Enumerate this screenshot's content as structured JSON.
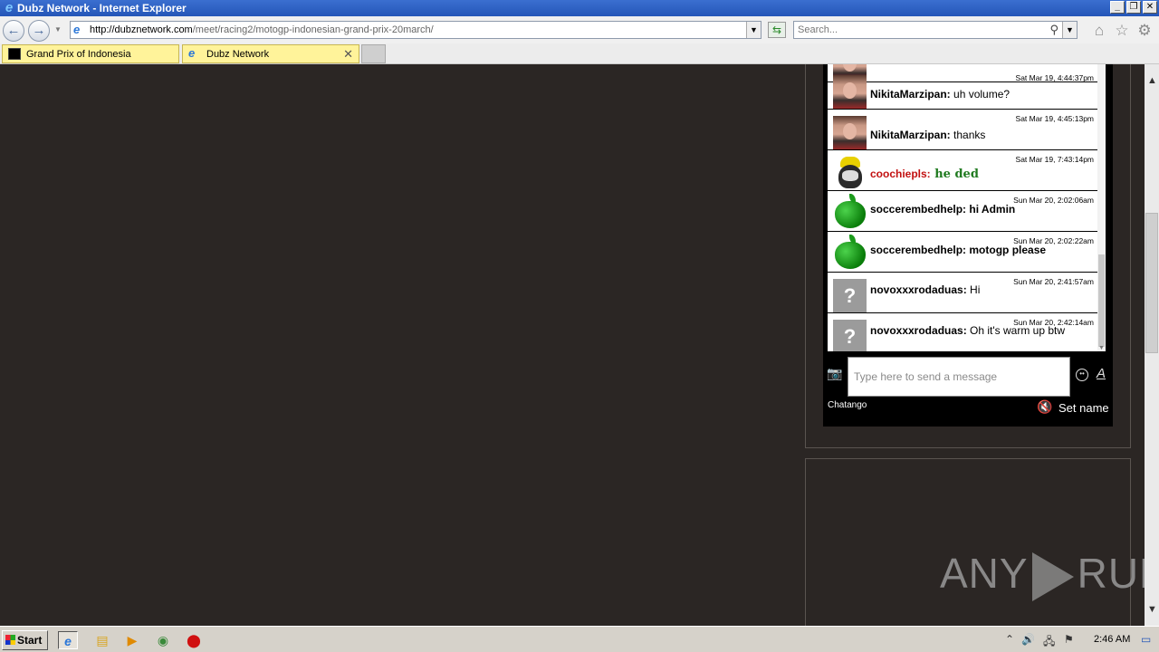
{
  "window": {
    "title": "Dubz Network - Internet Explorer"
  },
  "navbar": {
    "url_host": "http://dubznetwork.com",
    "url_path": "/meet/racing2/motogp-indonesian-grand-prix-20march/",
    "search_placeholder": "Search..."
  },
  "tabs": [
    {
      "label": "Grand Prix of Indonesia"
    },
    {
      "label": "Dubz Network"
    }
  ],
  "chat": {
    "messages": [
      {
        "time": "Sat Mar 19, 4:44:37pm",
        "user": "NikitaMarzipan:",
        "text": " uh volume?",
        "avatar": "racer-photo"
      },
      {
        "time": "Sat Mar 19, 4:45:13pm",
        "user": "NikitaMarzipan:",
        "text": " thanks",
        "avatar": "racer-photo"
      },
      {
        "time": "Sat Mar 19, 7:43:14pm",
        "user": "coochiepls:",
        "text": " he ded",
        "avatar": "skull-cap"
      },
      {
        "time": "Sun Mar 20, 2:02:06am",
        "user": "soccerembedhelp:",
        "text": " hi Admin",
        "avatar": "green-apple"
      },
      {
        "time": "Sun Mar 20, 2:02:22am",
        "user": "soccerembedhelp:",
        "text": " motogp please",
        "avatar": "green-apple"
      },
      {
        "time": "Sun Mar 20, 2:41:57am",
        "user": "novoxxxrodaduas:",
        "text": " Hi",
        "avatar": "question-mark"
      },
      {
        "time": "Sun Mar 20, 2:42:14am",
        "user": "novoxxxrodaduas:",
        "text": " Oh it's warm up btw",
        "avatar": "question-mark"
      }
    ],
    "input_placeholder": "Type here to send a message",
    "brand": "Chatango",
    "set_name": "Set name",
    "avatar_question": "?"
  },
  "watermark": {
    "left": "ANY",
    "right": "RUN"
  },
  "taskbar": {
    "start": "Start",
    "clock": "2:46 AM"
  },
  "colors": {
    "username_red": "#c21010",
    "message_green": "#1f7a1f",
    "tab_yellow": "#fff39a",
    "page_bg": "#2b2624"
  }
}
